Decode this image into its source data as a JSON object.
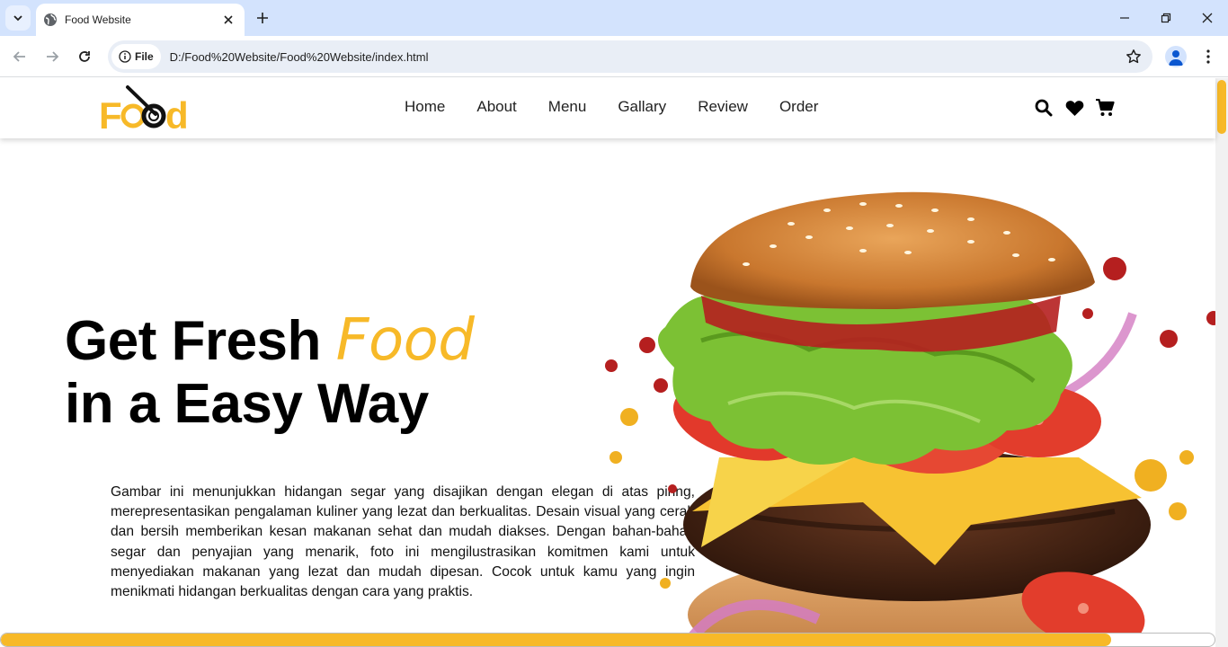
{
  "browser": {
    "tab_title": "Food Website",
    "site_chip": "File",
    "url": "D:/Food%20Website/Food%20Website/index.html"
  },
  "site": {
    "logo": "Food",
    "nav": [
      "Home",
      "About",
      "Menu",
      "Gallary",
      "Review",
      "Order"
    ],
    "icons": [
      "search-icon",
      "heart-icon",
      "cart-icon"
    ]
  },
  "hero": {
    "title_line1": "Get Fresh",
    "title_accent": "Food",
    "title_line2": "in a Easy Way",
    "description": "Gambar ini menunjukkan hidangan segar yang disajikan dengan elegan di atas piring, merepresentasikan pengalaman kuliner yang lezat dan berkualitas. Desain visual yang cerah dan bersih memberikan kesan makanan sehat dan mudah diakses. Dengan bahan-bahan segar dan penyajian yang menarik, foto ini mengilustrasikan komitmen kami untuk menyediakan makanan yang lezat dan mudah dipesan. Cocok untuk kamu yang ingin menikmati hidangan berkualitas dengan cara yang praktis."
  },
  "scroll_progress": 0.915,
  "colors": {
    "accent": "#f7b928",
    "tab_bar": "#d3e3fd",
    "omnibox": "#e9eef6"
  }
}
